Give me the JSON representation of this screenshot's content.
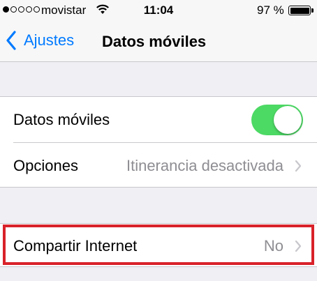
{
  "status_bar": {
    "carrier": "movistar",
    "time": "11:04",
    "battery": "97 %",
    "signal_bars_filled": 1,
    "signal_bars_total": 5,
    "battery_level": 0.97
  },
  "nav": {
    "back_label": "Ajustes",
    "title": "Datos móviles",
    "accent_color": "#007aff"
  },
  "settings": {
    "datos_moviles_label": "Datos móviles",
    "datos_moviles_toggle_on": true,
    "toggle_color": "#4cd964",
    "opciones_label": "Opciones",
    "opciones_value": "Itinerancia desactivada",
    "compartir_label": "Compartir Internet",
    "compartir_value": "No"
  },
  "highlight_color": "#d9222a"
}
